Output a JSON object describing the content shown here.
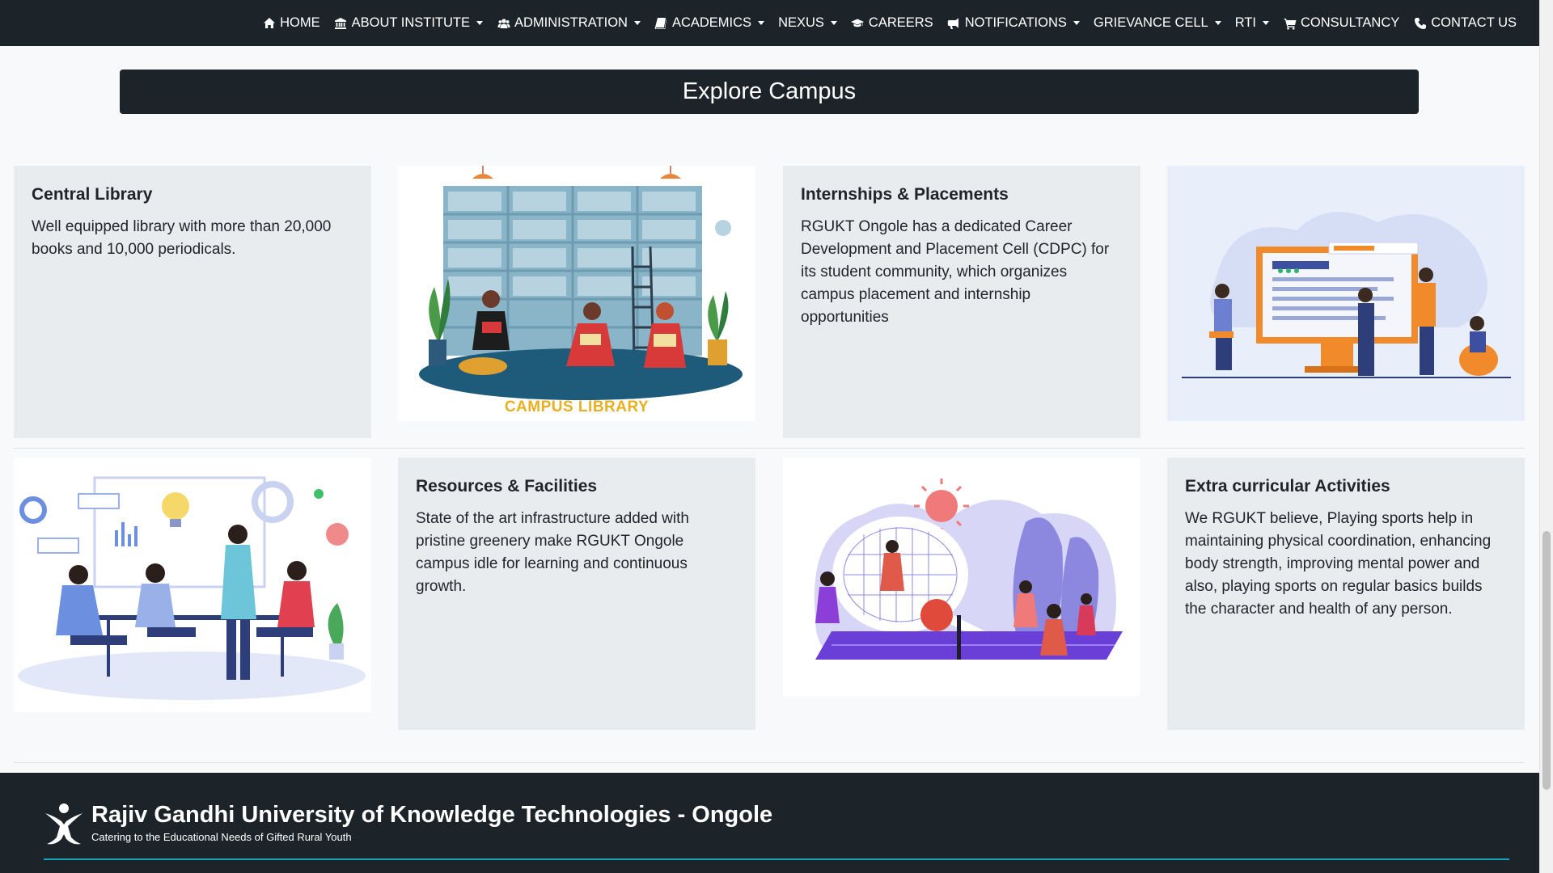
{
  "nav": {
    "items": [
      {
        "label": "HOME",
        "icon": "home-icon",
        "dropdown": false
      },
      {
        "label": "ABOUT INSTITUTE",
        "icon": "institution-icon",
        "dropdown": true
      },
      {
        "label": "ADMINISTRATION",
        "icon": "users-icon",
        "dropdown": true
      },
      {
        "label": "ACADEMICS",
        "icon": "book-icon",
        "dropdown": true
      },
      {
        "label": "NEXUS",
        "icon": "",
        "dropdown": true
      },
      {
        "label": "CAREERS",
        "icon": "graduation-cap-icon",
        "dropdown": false
      },
      {
        "label": "NOTIFICATIONS",
        "icon": "bullhorn-icon",
        "dropdown": true
      },
      {
        "label": "GRIEVANCE CELL",
        "icon": "",
        "dropdown": true
      },
      {
        "label": "RTI",
        "icon": "",
        "dropdown": true
      },
      {
        "label": "CONSULTANCY",
        "icon": "cart-icon",
        "dropdown": false
      },
      {
        "label": "CONTACT US",
        "icon": "phone-icon",
        "dropdown": false
      }
    ]
  },
  "explore": {
    "heading": "Explore Campus"
  },
  "cards": {
    "library": {
      "title": "Central Library",
      "text": "Well equipped library with more than 20,000 books and 10,000 periodicals."
    },
    "library_image": {
      "caption": "CAMPUS LIBRARY"
    },
    "placements": {
      "title": "Internships & Placements",
      "text": "RGUKT Ongole has a dedicated Career Development and Placement Cell (CDPC) for its student community, which organizes campus placement and internship opportunities"
    },
    "resources": {
      "title": "Resources & Facilities",
      "text": "State of the art infrastructure added with pristine greenery make RGUKT Ongole campus idle for learning and continuous growth."
    },
    "extracurricular": {
      "title": "Extra curricular Activities",
      "text": "We RGUKT believe, Playing sports help in maintaining physical coordination, enhancing body strength, improving mental power and also, playing sports on regular basics builds the character and health of any person."
    }
  },
  "footer": {
    "title": "Rajiv Gandhi University of Knowledge Technologies - Ongole",
    "tagline": "Catering to the Educational Needs of Gifted Rural Youth"
  },
  "colors": {
    "navbar": "#1d2429",
    "card_bg": "#e9ecef",
    "footer_rule": "#17a2b8"
  }
}
